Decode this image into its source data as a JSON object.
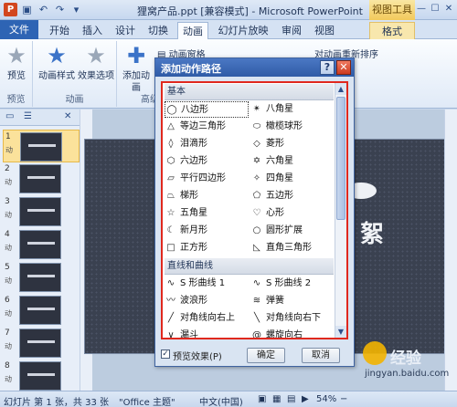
{
  "window": {
    "title": "狸窝产品.ppt [兼容模式] - Microsoft PowerPoint",
    "context_tab_title": "视图工具"
  },
  "tabs": [
    "文件",
    "开始",
    "插入",
    "设计",
    "切换",
    "动画",
    "幻灯片放映",
    "审阅",
    "视图",
    "格式"
  ],
  "ribbon": {
    "preview": {
      "label": "预览",
      "group": "预览"
    },
    "anim_style": "动画样式",
    "effect_options": "效果选项",
    "anim_group": "动画",
    "add_animation": "添加动画",
    "anim_pane": "动画窗格",
    "adv_group": "高级",
    "reorder": "对动画重新排序"
  },
  "slides": [
    {
      "num": "1",
      "anim": "动"
    },
    {
      "num": "2",
      "anim": "动"
    },
    {
      "num": "3",
      "anim": "动"
    },
    {
      "num": "4",
      "anim": "动"
    },
    {
      "num": "5",
      "anim": "动"
    },
    {
      "num": "6",
      "anim": "动"
    },
    {
      "num": "7",
      "anim": "动"
    },
    {
      "num": "8",
      "anim": "动"
    }
  ],
  "dialog": {
    "title": "添加动作路径",
    "help": "?",
    "close": "✕",
    "sections": [
      "基本",
      "直线和曲线"
    ],
    "basic_items": [
      [
        "八边形",
        "八角星"
      ],
      [
        "等边三角形",
        "橄榄球形"
      ],
      [
        "泪滴形",
        "菱形"
      ],
      [
        "六边形",
        "六角星"
      ],
      [
        "平行四边形",
        "四角星"
      ],
      [
        "梯形",
        "五边形"
      ],
      [
        "五角星",
        "心形"
      ],
      [
        "新月形",
        "圆形扩展"
      ],
      [
        "正方形",
        "直角三角形"
      ]
    ],
    "line_items": [
      [
        "S 形曲线 1",
        "S 形曲线 2"
      ],
      [
        "波浪形",
        "弹簧"
      ],
      [
        "对角线向右上",
        "对角线向右下"
      ],
      [
        "漏斗",
        "螺旋向右"
      ]
    ],
    "preview_label": "预览效果(P)",
    "ok": "确定",
    "cancel": "取消"
  },
  "statusbar": {
    "slide_info": "幻灯片 第 1 张，共 33 张",
    "theme": "\"Office 主题\"",
    "lang": "中文(中国)",
    "zoom": "54%"
  },
  "slide_text": "絮",
  "watermark": {
    "text": "经验",
    "url": "jingyan.baidu.com"
  }
}
